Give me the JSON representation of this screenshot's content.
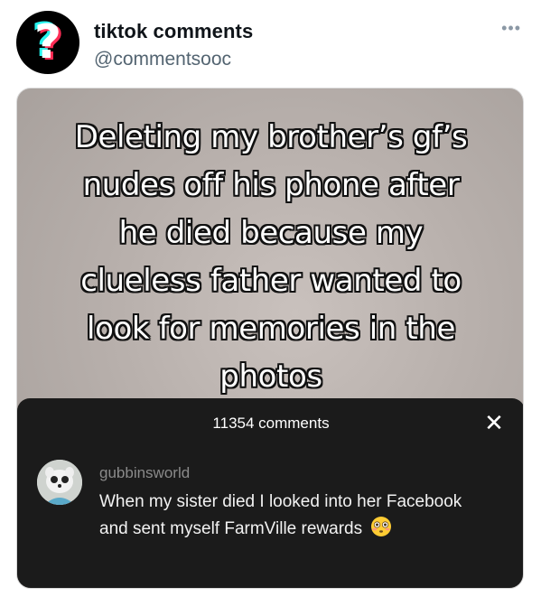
{
  "tweet": {
    "display_name": "tiktok comments",
    "handle": "@commentsooc",
    "more_icon": "more-horizontal-icon",
    "avatar_glyph": "?"
  },
  "video": {
    "caption": "Deleting my brother’s gf’s\nnudes off his phone after\nhe died because my\nclueless father wanted to\nlook for memories in the\nphotos"
  },
  "comments_panel": {
    "count_label": "11354 comments",
    "close_icon": "close-icon",
    "close_glyph": "✕",
    "comment": {
      "username": "gubbinsworld",
      "text": "When my sister died I looked into her Facebook and sent myself FarmVille rewards",
      "emoji": "flushed-face-emoji"
    }
  },
  "colors": {
    "panel_bg": "#1b1b1b",
    "handle": "#536471",
    "tiktok_cyan": "#25f4ee",
    "tiktok_pink": "#fe2c55"
  }
}
